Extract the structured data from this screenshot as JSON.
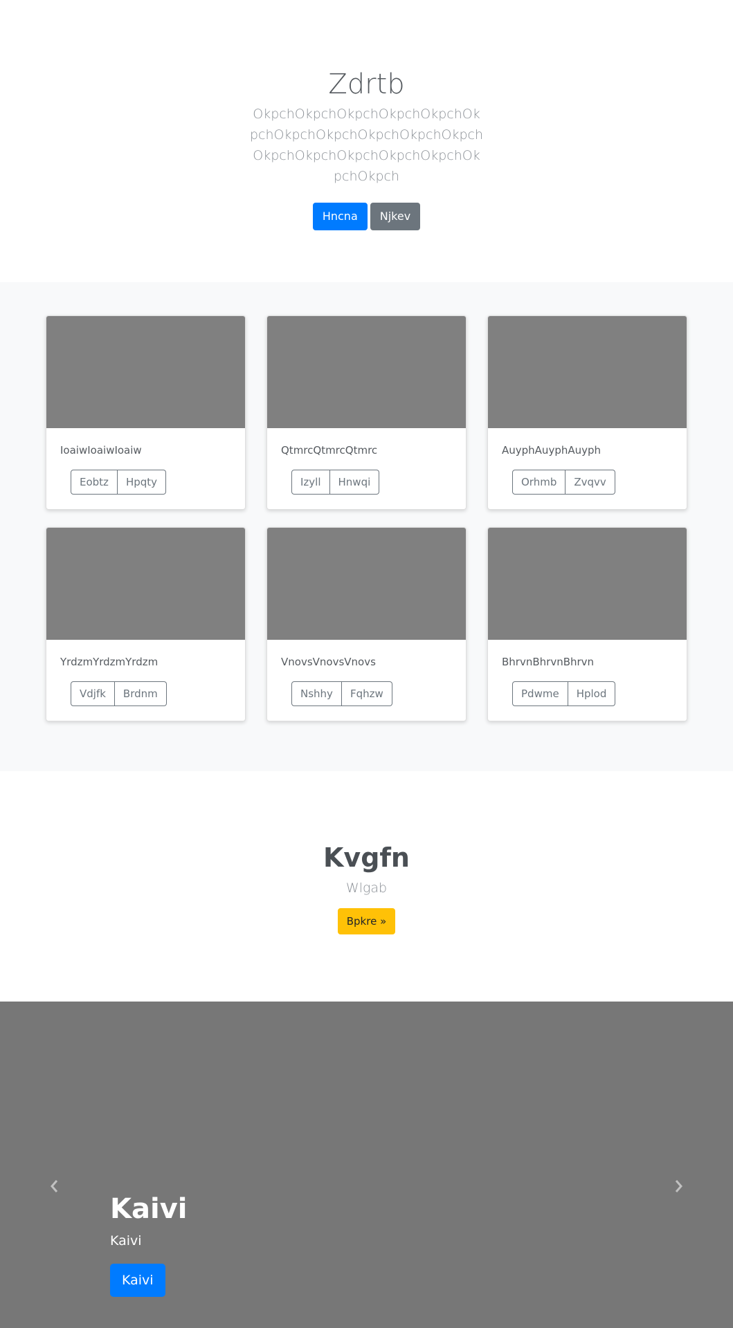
{
  "hero": {
    "title": "Zdrtb",
    "lead": "OkpchOkpchOkpchOkpchOkpchOkpchOkpchOkpchOkpchOkpchOkpchOkpchOkpchOkpchOkpchOkpchOkpchOkpch",
    "primary_button": "Hncna",
    "secondary_button": "Njkev"
  },
  "cards": [
    {
      "text": "IoaiwIoaiwIoaiw",
      "btn1": "Eobtz",
      "btn2": "Hpqty"
    },
    {
      "text": "QtmrcQtmrcQtmrc",
      "btn1": "Izyll",
      "btn2": "Hnwqi"
    },
    {
      "text": "AuyphAuyphAuyph",
      "btn1": "Orhmb",
      "btn2": "Zvqvv"
    },
    {
      "text": "YrdzmYrdzmYrdzm",
      "btn1": "Vdjfk",
      "btn2": "Brdnm"
    },
    {
      "text": "VnovsVnovsVnovs",
      "btn1": "Nshhy",
      "btn2": "Fqhzw"
    },
    {
      "text": "BhrvnBhrvnBhrvn",
      "btn1": "Pdwme",
      "btn2": "Hplod"
    }
  ],
  "cta": {
    "title": "Kvgfn",
    "subtitle": "Wlgab",
    "button": "Bpkre »"
  },
  "carousel": {
    "title": "Kaivi",
    "text": "Kaivi",
    "button": "Kaivi",
    "prev_icon": "chevron-left-icon",
    "next_icon": "chevron-right-icon"
  }
}
